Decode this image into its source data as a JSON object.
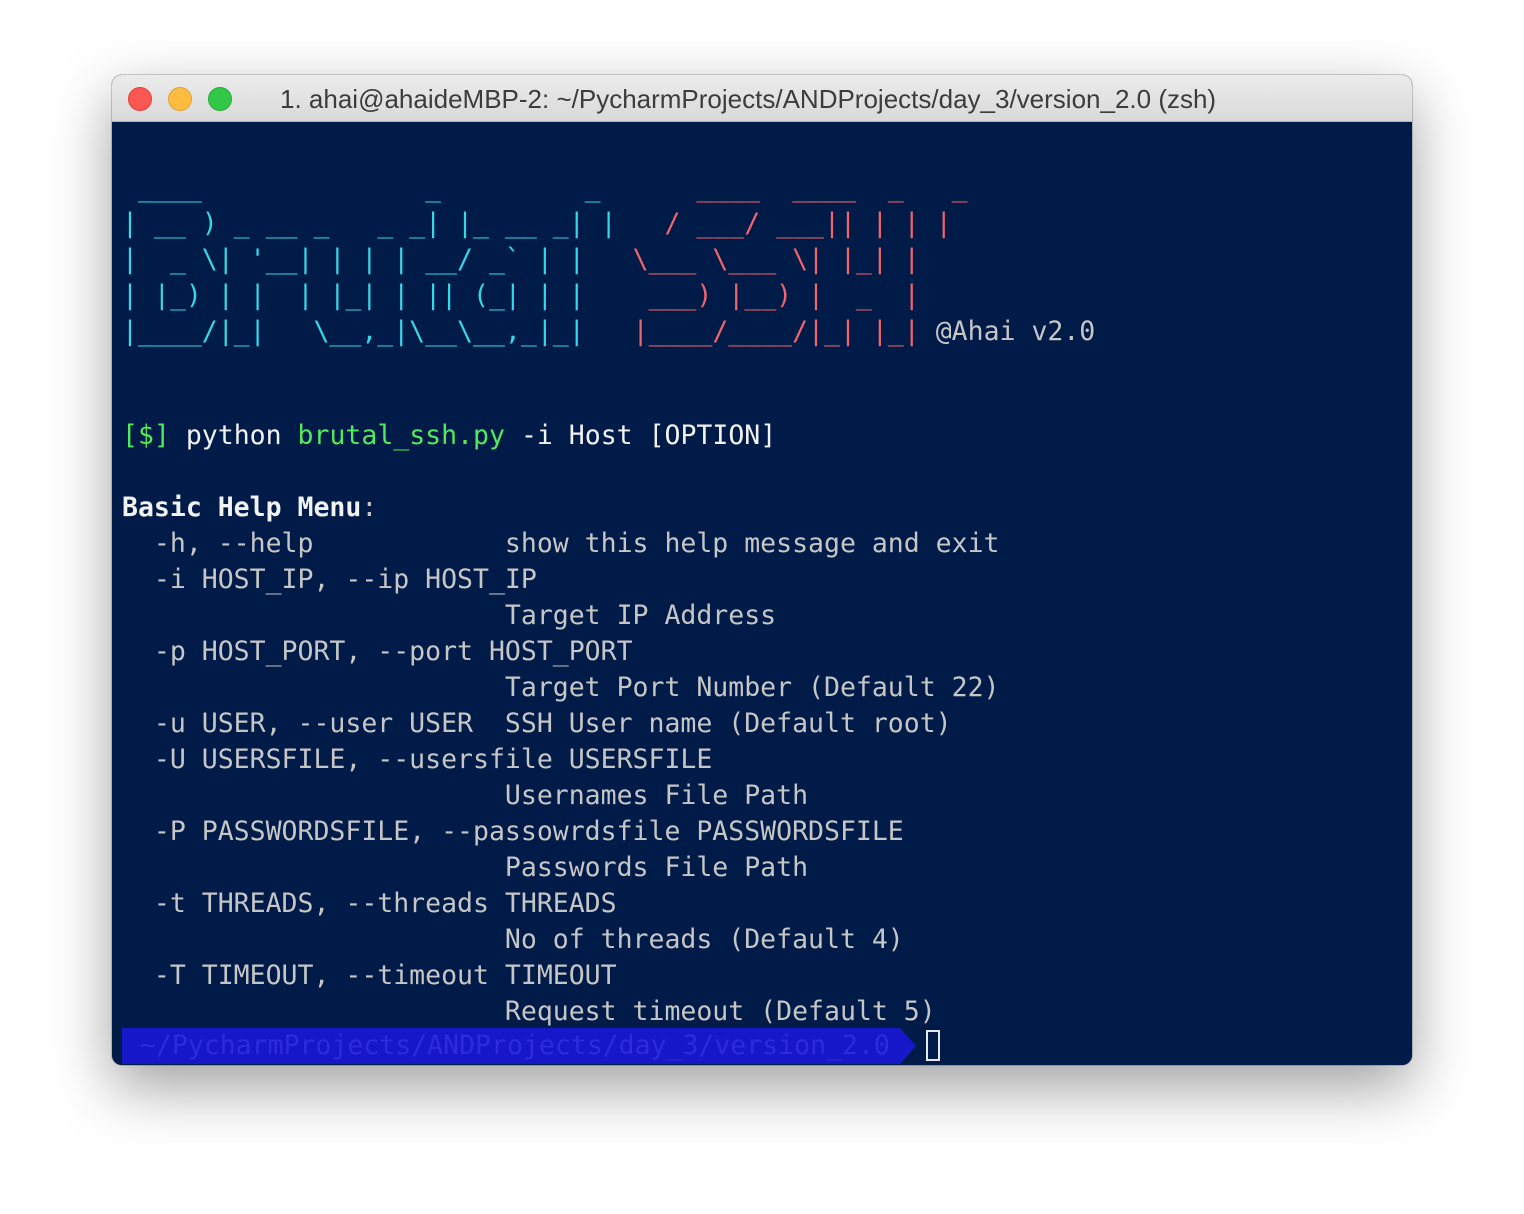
{
  "window": {
    "title": "1. ahai@ahaideMBP-2: ~/PycharmProjects/ANDProjects/day_3/version_2.0 (zsh)"
  },
  "banner": {
    "brutal_lines": [
      " ____              _         _ ",
      "| __ ) _ __ _   _ _| |_ __ _| |",
      "|  _ \\| '__| | | | __/ _` | |",
      "| |_) | |  | |_| | || (_| | |",
      "|____/|_|   \\__,_|\\__\\__,_|_|"
    ],
    "ssh_lines": [
      " ____  ____  _   _ ",
      "/ ___/ ___|| | | |",
      "\\___ \\___ \\| |_| |",
      " ___) |__) |  _  |",
      "|____/____/|_| |_|"
    ],
    "signature": "@Ahai v2.0"
  },
  "usage": {
    "prefix": "[$]",
    "cmd": "python",
    "script": "brutal_ssh.py",
    "args": "-i Host [OPTION]"
  },
  "help": {
    "heading": "Basic Help Menu",
    "colon": ":",
    "lines": [
      "  -h, --help            show this help message and exit",
      "  -i HOST_IP, --ip HOST_IP",
      "                        Target IP Address",
      "  -p HOST_PORT, --port HOST_PORT",
      "                        Target Port Number (Default 22)",
      "  -u USER, --user USER  SSH User name (Default root)",
      "  -U USERSFILE, --usersfile USERSFILE",
      "                        Usernames File Path",
      "  -P PASSWORDSFILE, --passowrdsfile PASSWORDSFILE",
      "                        Passwords File Path",
      "  -t THREADS, --threads THREADS",
      "                        No of threads (Default 4)",
      "  -T TIMEOUT, --timeout TIMEOUT",
      "                        Request timeout (Default 5)"
    ]
  },
  "prompt": {
    "path": "~/PycharmProjects/ANDProjects/day_3/version_2.0"
  },
  "colors": {
    "terminal_bg": "#001b48",
    "banner_cyan": "#37d6e6",
    "banner_red": "#f0646a",
    "prompt_green": "#54e85c",
    "prompt_bar": "#1617c8"
  }
}
